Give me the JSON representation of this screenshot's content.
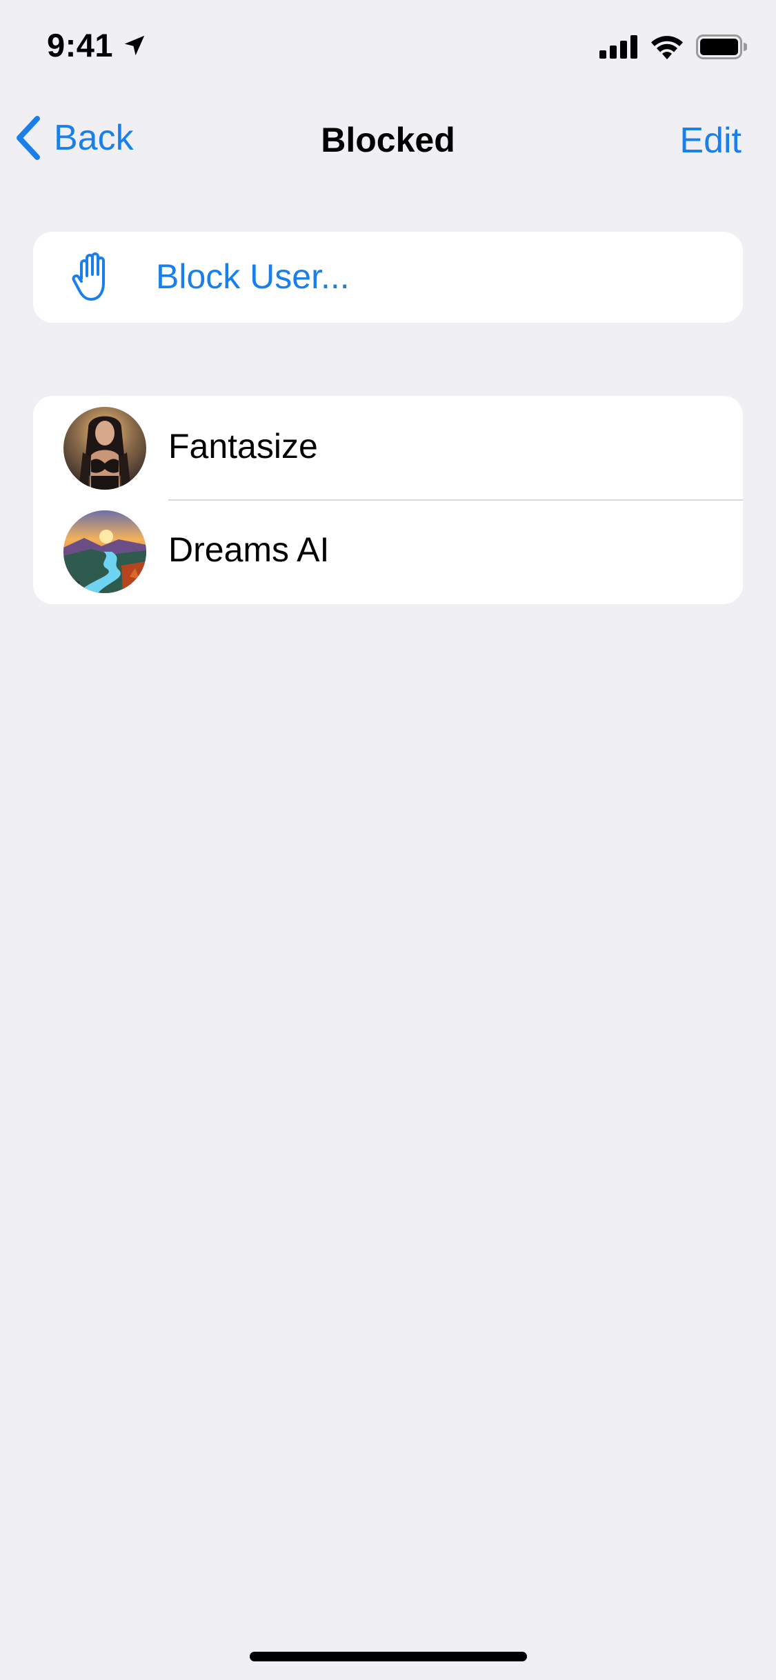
{
  "status_bar": {
    "time": "9:41",
    "icons": [
      "location-arrow-icon",
      "cellular-signal-icon",
      "wifi-icon",
      "battery-icon"
    ]
  },
  "nav": {
    "back_label": "Back",
    "title": "Blocked",
    "edit_label": "Edit"
  },
  "block_action": {
    "icon": "hand-raised-icon",
    "label": "Block User..."
  },
  "blocked_users": [
    {
      "name": "Fantasize",
      "avatar": "portrait-photo"
    },
    {
      "name": "Dreams AI",
      "avatar": "landscape-sunset-photo"
    }
  ],
  "colors": {
    "accent": "#1A7FE8",
    "background": "#EFEFF4",
    "card": "#FFFFFF",
    "divider": "#D8D8DC"
  }
}
